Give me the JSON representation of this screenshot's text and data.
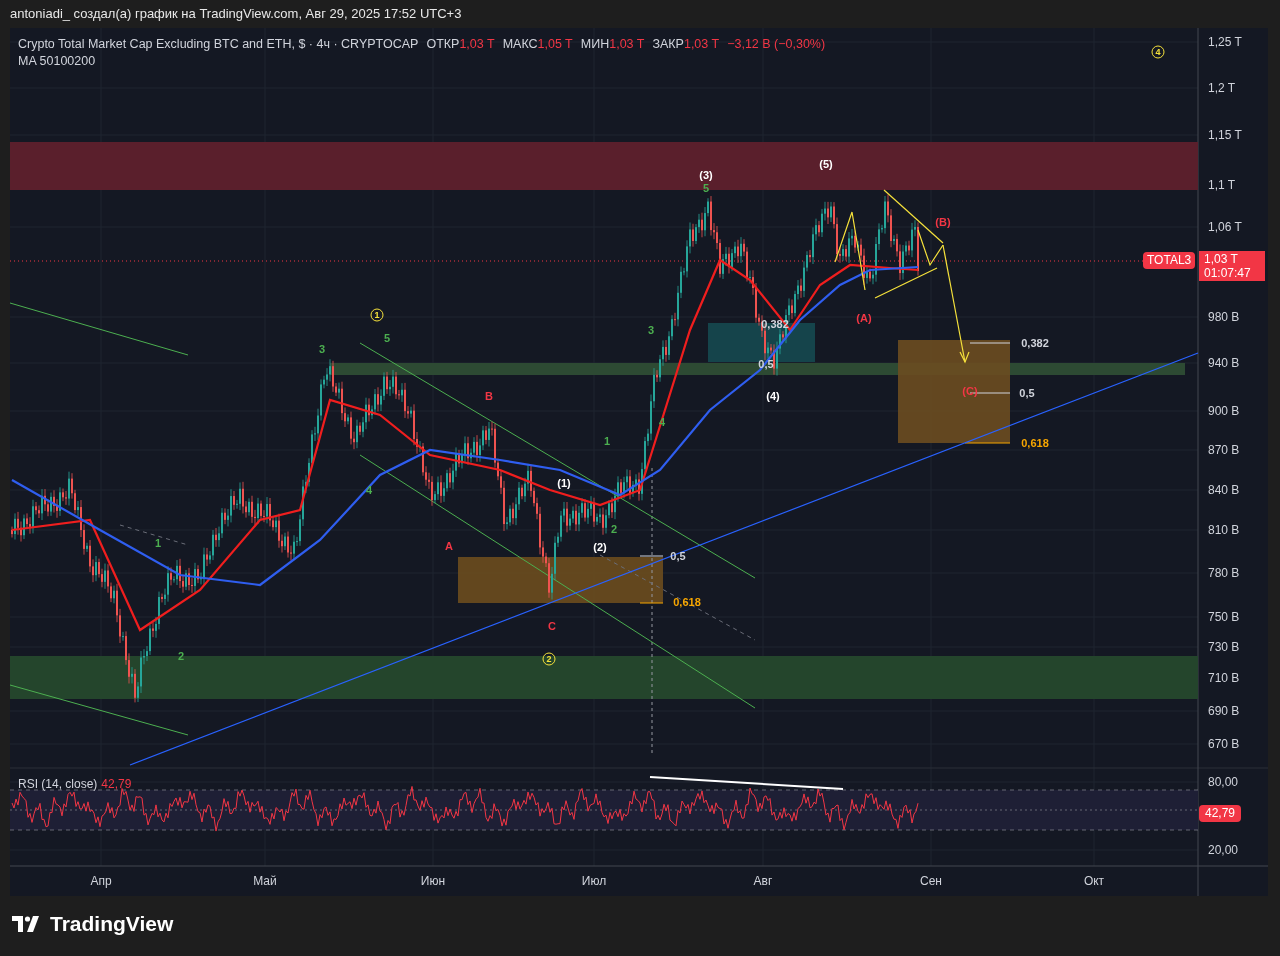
{
  "header": {
    "text": "antoniadi_ создал(а) график на TradingView.com, Авг 29, 2025 17:52 UTC+3"
  },
  "legend": {
    "symbol": "Crypto Total Market Cap Excluding BTC and ETH, $ · 4ч · CRYPTOCAP",
    "ohlc": [
      {
        "label": "ОТКР",
        "value": "1,03 T"
      },
      {
        "label": "МАКС",
        "value": "1,05 T"
      },
      {
        "label": "МИН",
        "value": "1,03 T"
      },
      {
        "label": "ЗАКР",
        "value": "1,03 T"
      }
    ],
    "change": "−3,12 B (−0,30%)",
    "indicator": "MA 50100200"
  },
  "annotations": [
    {
      "text": "4",
      "color": "#f5e13b",
      "kind": "circled"
    },
    {
      "text": "(5)",
      "color": "#ffffff",
      "kind": "plain"
    },
    {
      "text": "(3)",
      "color": "#ffffff",
      "kind": "plain"
    },
    {
      "text": "5",
      "color": "#4caf50",
      "kind": "plain"
    },
    {
      "text": "(B)",
      "color": "#f23645",
      "kind": "plain"
    },
    {
      "text": "1",
      "color": "#f5e13b",
      "kind": "circled"
    },
    {
      "text": "(A)",
      "color": "#f23645",
      "kind": "plain"
    },
    {
      "text": "0,382",
      "color": "#d1d4dc",
      "kind": "plain"
    },
    {
      "text": "0,382",
      "color": "#d1d4dc",
      "kind": "plain"
    },
    {
      "text": "3",
      "color": "#4caf50",
      "kind": "plain"
    },
    {
      "text": "5",
      "color": "#4caf50",
      "kind": "plain"
    },
    {
      "text": "3",
      "color": "#4caf50",
      "kind": "plain"
    },
    {
      "text": "0,5",
      "color": "#d1d4dc",
      "kind": "plain"
    },
    {
      "text": "B",
      "color": "#f23645",
      "kind": "plain"
    },
    {
      "text": "(4)",
      "color": "#ffffff",
      "kind": "plain"
    },
    {
      "text": "(C)",
      "color": "#f23645",
      "kind": "plain"
    },
    {
      "text": "0,5",
      "color": "#d1d4dc",
      "kind": "plain"
    },
    {
      "text": "4",
      "color": "#4caf50",
      "kind": "plain"
    },
    {
      "text": "1",
      "color": "#4caf50",
      "kind": "plain"
    },
    {
      "text": "0,618",
      "color": "#f7a600",
      "kind": "plain"
    },
    {
      "text": "(1)",
      "color": "#ffffff",
      "kind": "plain"
    },
    {
      "text": "4",
      "color": "#4caf50",
      "kind": "plain"
    },
    {
      "text": "2",
      "color": "#4caf50",
      "kind": "plain"
    },
    {
      "text": "1",
      "color": "#4caf50",
      "kind": "plain"
    },
    {
      "text": "A",
      "color": "#f23645",
      "kind": "plain"
    },
    {
      "text": "(2)",
      "color": "#ffffff",
      "kind": "plain"
    },
    {
      "text": "0,5",
      "color": "#d1d4dc",
      "kind": "plain"
    },
    {
      "text": "0,618",
      "color": "#f7a600",
      "kind": "plain"
    },
    {
      "text": "C",
      "color": "#f23645",
      "kind": "plain"
    },
    {
      "text": "2",
      "color": "#4caf50",
      "kind": "plain"
    },
    {
      "text": "2",
      "color": "#f5e13b",
      "kind": "circled"
    }
  ],
  "price_axis": {
    "ticks": [
      "1,25 T",
      "1,2 T",
      "1,15 T",
      "1,1 T",
      "1,06 T",
      "980 B",
      "940 B",
      "900 B",
      "870 B",
      "840 B",
      "810 B",
      "780 B",
      "750 B",
      "730 B",
      "710 B",
      "690 B",
      "670 B"
    ],
    "last_price": {
      "symbol": "TOTAL3",
      "price": "1,03 T",
      "countdown": "01:07:47"
    }
  },
  "rsi": {
    "title": "RSI (14, close)",
    "value": "42,79",
    "ticks": [
      "80,00",
      "20,00"
    ],
    "value_tag": "42,79"
  },
  "time_axis": {
    "labels": [
      "Апр",
      "Май",
      "Июн",
      "Июл",
      "Авг",
      "Сен",
      "Окт"
    ]
  },
  "footer": {
    "brand": "TradingView"
  }
}
